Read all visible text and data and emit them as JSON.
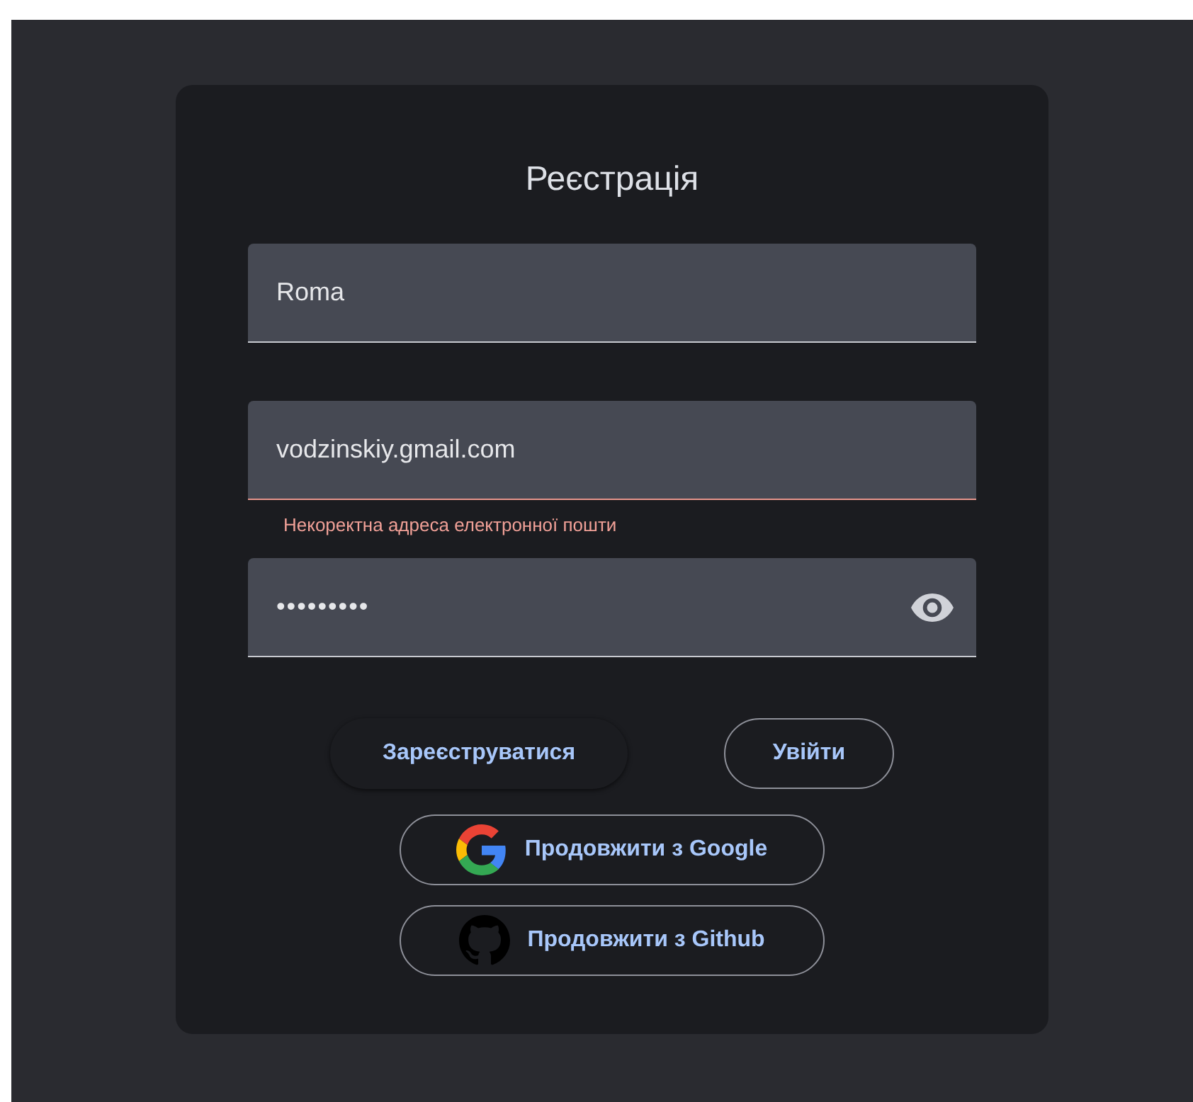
{
  "title": "Реєстрація",
  "fields": [
    {
      "kind": "text",
      "value": "Roma",
      "invalid": false
    },
    {
      "kind": "email",
      "value": "vodzinskiy.gmail.com",
      "invalid": true,
      "error": "Некоректна адреса електронної пошти"
    },
    {
      "kind": "password",
      "value": "•••••••••",
      "invalid": false
    }
  ],
  "actions": [
    {
      "kind": "elevated",
      "label": "Зареєструватися"
    },
    {
      "kind": "outlined",
      "label": "Увійти"
    }
  ],
  "social": [
    {
      "kind": "google",
      "label": "Продовжити з Google"
    },
    {
      "kind": "github",
      "label": "Продовжити з Github"
    }
  ]
}
